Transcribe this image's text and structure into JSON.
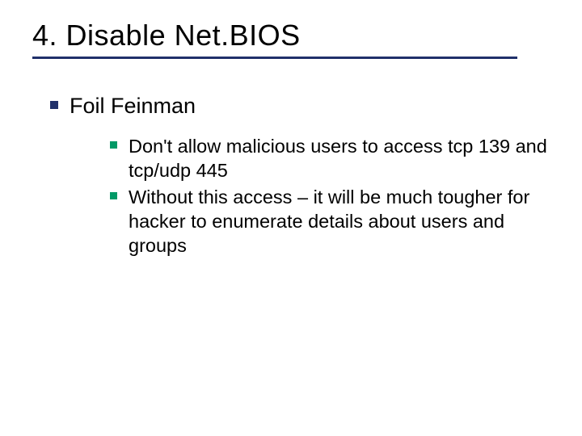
{
  "slide": {
    "title": "4. Disable Net.BIOS",
    "bullets": [
      {
        "text": "Foil Feinman",
        "children": [
          {
            "text": "Don't allow malicious users to access tcp 139 and tcp/udp 445"
          },
          {
            "text": "Without this access – it will be much tougher for hacker to enumerate details about users and groups"
          }
        ]
      }
    ]
  },
  "colors": {
    "rule": "#20306a",
    "bullet_level1": "#20306a",
    "bullet_level2": "#009966"
  }
}
